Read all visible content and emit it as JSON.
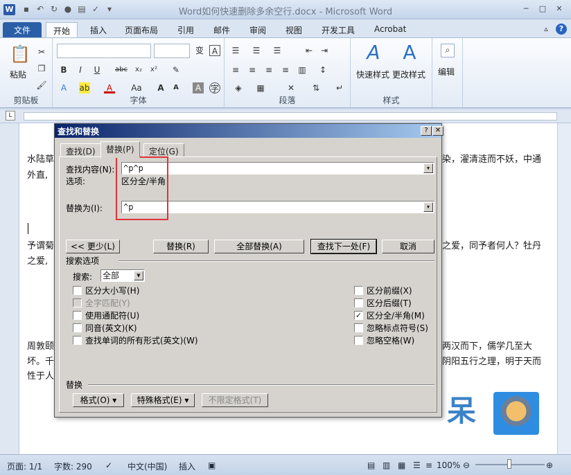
{
  "window": {
    "title": "Word如何快速删除多余空行.docx - Microsoft Word",
    "logo": "W"
  },
  "ribbon_tabs": [
    "文件",
    "开始",
    "插入",
    "页面布局",
    "引用",
    "邮件",
    "审阅",
    "视图",
    "开发工具",
    "Acrobat"
  ],
  "active_tab": "开始",
  "ribbon": {
    "clipboard": {
      "paste_label": "粘贴",
      "group_label": "剪贴板"
    },
    "font": {
      "group_label": "字体"
    },
    "paragraph": {
      "group_label": "段落"
    },
    "styles": {
      "quick_label": "快速样式",
      "change_label": "更改样式",
      "group_label": "样式"
    },
    "editing": {
      "label": "编辑"
    }
  },
  "document": {
    "lines": [
      "水陆草",
      "外直,",
      "予谓菊",
      "之爱,",
      "周敦颐",
      "坏。千",
      "性于人"
    ],
    "right_lines": [
      "染，濯清涟而不妖，中通",
      "之爱，同予者何人？牡丹",
      "两汉而下，儒学几至大",
      "阴阳五行之理，明于天而"
    ],
    "pic_text": "呆"
  },
  "dialog": {
    "title": "查找和替换",
    "help_btn": "?",
    "close_btn": "✕",
    "tabs": [
      "查找(D)",
      "替换(P)",
      "定位(G)"
    ],
    "active_tab": "替换(P)",
    "find_label": "查找内容(N):",
    "find_value": "^p^p",
    "options_label": "选项:",
    "options_value": "区分全/半角",
    "replace_label": "替换为(I):",
    "replace_value": "^p",
    "buttons": {
      "less": "<< 更少(L)",
      "replace": "替换(R)",
      "replace_all": "全部替换(A)",
      "find_next": "查找下一处(F)",
      "cancel": "取消"
    },
    "search_options_title": "搜索选项",
    "search_label": "搜索:",
    "search_value": "全部",
    "left_checks": [
      {
        "label": "区分大小写(H)",
        "checked": false,
        "disabled": false
      },
      {
        "label": "全字匹配(Y)",
        "checked": false,
        "disabled": true
      },
      {
        "label": "使用通配符(U)",
        "checked": false,
        "disabled": false
      },
      {
        "label": "同音(英文)(K)",
        "checked": false,
        "disabled": false
      },
      {
        "label": "查找单词的所有形式(英文)(W)",
        "checked": false,
        "disabled": false
      }
    ],
    "right_checks": [
      {
        "label": "区分前缀(X)",
        "checked": false
      },
      {
        "label": "区分后缀(T)",
        "checked": false
      },
      {
        "label": "区分全/半角(M)",
        "checked": true
      },
      {
        "label": "忽略标点符号(S)",
        "checked": false
      },
      {
        "label": "忽略空格(W)",
        "checked": false
      }
    ],
    "replace_section": "替换",
    "format_btn": "格式(O) ▾",
    "special_btn": "特殊格式(E) ▾",
    "no_format_btn": "不限定格式(T)"
  },
  "statusbar": {
    "page": "页面: 1/1",
    "words": "字数: 290",
    "lang": "中文(中国)",
    "mode": "插入",
    "zoom": "100%"
  },
  "colors": {
    "accent": "#2a5fa8",
    "highlight_box": "#e0333a"
  }
}
